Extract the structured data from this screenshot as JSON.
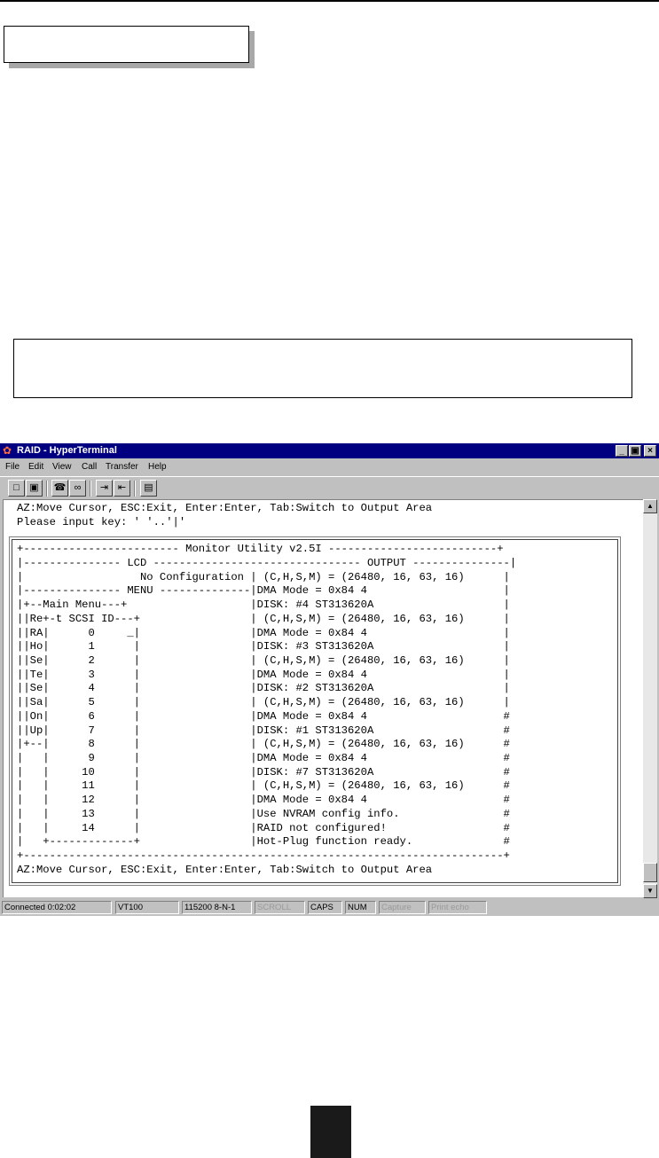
{
  "window": {
    "title": "RAID - HyperTerminal",
    "controls": [
      "_",
      "▣",
      "×"
    ]
  },
  "menu": [
    "File",
    "Edit",
    "View",
    "Call",
    "Transfer",
    "Help"
  ],
  "toolbar": {
    "icons": [
      "new-document-icon",
      "open-folder-icon",
      "phone-icon",
      "disconnect-icon",
      "send-icon",
      "receive-icon",
      "properties-icon"
    ]
  },
  "terminal": {
    "lines": [
      "AZ:Move Cursor, ESC:Exit, Enter:Enter, Tab:Switch to Output Area",
      "Please input key: ' '..'|'",
      "",
      "+------------------------ Monitor Utility v2.5I --------------------------+",
      "|--------------- LCD -------------------------------- OUTPUT ---------------|",
      "|                  No Configuration | (C,H,S,M) = (26480, 16, 63, 16)      |",
      "|--------------- MENU --------------|DMA Mode = 0x84 4                     |",
      "|+--Main Menu---+                   |DISK: #4 ST313620A                    |",
      "||Re+-t SCSI ID---+                 | (C,H,S,M) = (26480, 16, 63, 16)      |",
      "||RA|      0     _|                 |DMA Mode = 0x84 4                     |",
      "||Ho|      1      |                 |DISK: #3 ST313620A                    |",
      "||Se|      2      |                 | (C,H,S,M) = (26480, 16, 63, 16)      |",
      "||Te|      3      |                 |DMA Mode = 0x84 4                     |",
      "||Se|      4      |                 |DISK: #2 ST313620A                    |",
      "||Sa|      5      |                 | (C,H,S,M) = (26480, 16, 63, 16)      |",
      "||On|      6      |                 |DMA Mode = 0x84 4                     #",
      "||Up|      7      |                 |DISK: #1 ST313620A                    #",
      "|+--|      8      |                 | (C,H,S,M) = (26480, 16, 63, 16)      #",
      "|   |      9      |                 |DMA Mode = 0x84 4                     #",
      "|   |     10      |                 |DISK: #7 ST313620A                    #",
      "|   |     11      |                 | (C,H,S,M) = (26480, 16, 63, 16)      #",
      "|   |     12      |                 |DMA Mode = 0x84 4                     #",
      "|   |     13      |                 |Use NVRAM config info.                #",
      "|   |     14      |                 |RAID not configured!                  #",
      "|   +-------------+                 |Hot-Plug function ready.              #",
      "+--------------------------------------------------------------------------+",
      "AZ:Move Cursor, ESC:Exit, Enter:Enter, Tab:Switch to Output Area"
    ]
  },
  "status": {
    "connected": "Connected 0:02:02",
    "emulation": "VT100",
    "port": "115200 8-N-1",
    "scroll": "SCROLL",
    "caps": "CAPS",
    "num": "NUM",
    "capture": "Capture",
    "print_echo": "Print echo"
  }
}
